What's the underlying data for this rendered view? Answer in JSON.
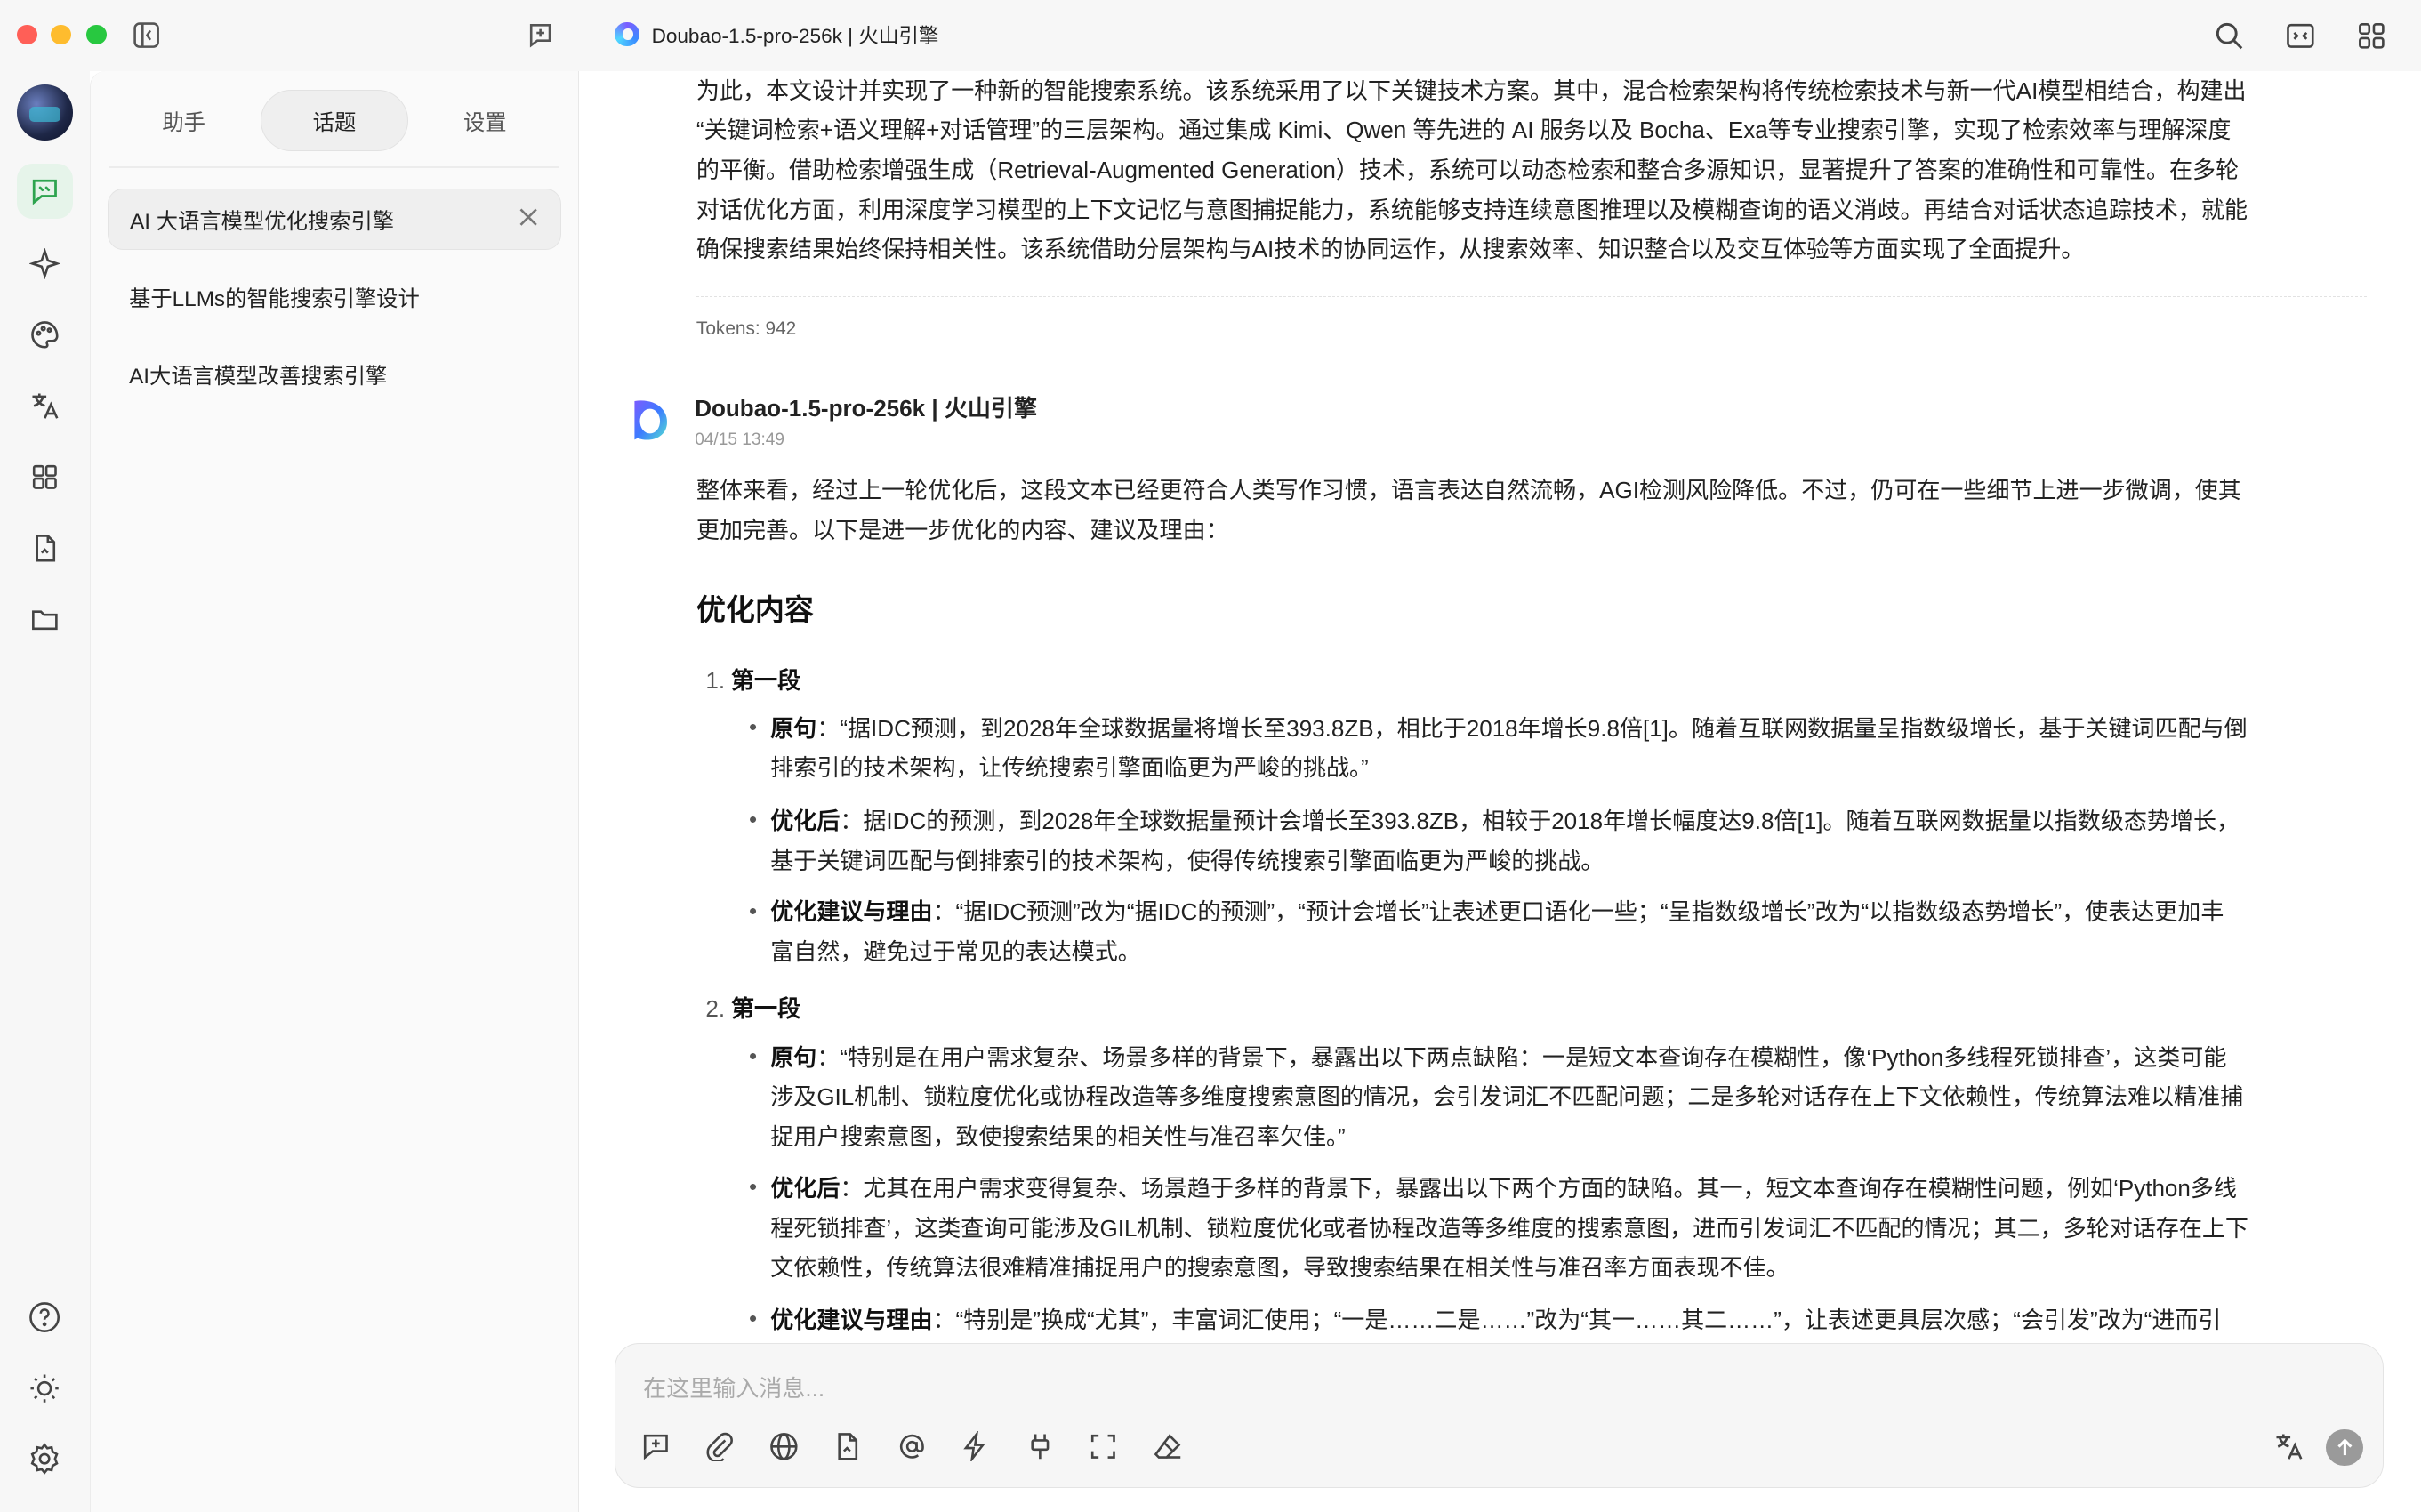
{
  "window": {
    "title": "Doubao-1.5-pro-256k | 火山引擎"
  },
  "panel": {
    "tabs": [
      "助手",
      "话题",
      "设置"
    ],
    "active_tab": "话题",
    "topics": [
      "AI 大语言模型优化搜索引擎",
      "基于LLMs的智能搜索引擎设计",
      "AI大语言模型改善搜索引擎"
    ]
  },
  "prev_message": {
    "lines": [
      "为此，本文设计并实现了一种新的智能搜索系统。该系统采用了以下关键技术方案。其中，混合检索架构将传统检索技术与新一代AI模型相结合，构建出",
      "“关键词检索+语义理解+对话管理”的三层架构。通过集成 Kimi、Qwen 等先进的 AI 服务以及 Bocha、Exa等专业搜索引擎，实现了检索效率与理解深度",
      "的平衡。借助检索增强生成（Retrieval-Augmented Generation）技术，系统可以动态检索和整合多源知识，显著提升了答案的准确性和可靠性。在多轮",
      "对话优化方面，利用深度学习模型的上下文记忆与意图捕捉能力，系统能够支持连续意图推理以及模糊查询的语义消歧。再结合对话状态追踪技术，就能",
      "确保搜索结果始终保持相关性。该系统借助分层架构与AI技术的协同运作，从搜索效率、知识整合以及交互体验等方面实现了全面提升。"
    ],
    "tokens": "Tokens: 942"
  },
  "message": {
    "model": "Doubao-1.5-pro-256k | 火山引擎",
    "time": "04/15 13:49",
    "intro": [
      "整体来看，经过上一轮优化后，这段文本已经更符合人类写作习惯，语言表达自然流畅，AGI检测风险降低。不过，仍可在一些细节上进一步微调，使其",
      "更加完善。以下是进一步优化的内容、建议及理由："
    ],
    "heading": "优化内容",
    "sections": [
      {
        "num": "1.",
        "title": "第一段",
        "items": [
          {
            "label": "原句",
            "lines": [
              "：“据IDC预测，到2028年全球数据量将增长至393.8ZB，相比于2018年增长9.8倍[1]。随着互联网数据量呈指数级增长，基于关键词匹配与倒",
              "排索引的技术架构，让传统搜索引擎面临更为严峻的挑战。”"
            ]
          },
          {
            "label": "优化后",
            "lines": [
              "：据IDC的预测，到2028年全球数据量预计会增长至393.8ZB，相较于2018年增长幅度达9.8倍[1]。随着互联网数据量以指数级态势增长，",
              "基于关键词匹配与倒排索引的技术架构，使得传统搜索引擎面临更为严峻的挑战。"
            ]
          },
          {
            "label": "优化建议与理由",
            "lines": [
              "：“据IDC预测”改为“据IDC的预测”，“预计会增长”让表述更口语化一些；“呈指数级增长”改为“以指数级态势增长”，使表达更加丰",
              "富自然，避免过于常见的表达模式。"
            ]
          }
        ]
      },
      {
        "num": "2.",
        "title": "第一段",
        "items": [
          {
            "label": "原句",
            "lines": [
              "：“特别是在用户需求复杂、场景多样的背景下，暴露出以下两点缺陷：一是短文本查询存在模糊性，像‘Python多线程死锁排查’，这类可能",
              "涉及GIL机制、锁粒度优化或协程改造等多维度搜索意图的情况，会引发词汇不匹配问题；二是多轮对话存在上下文依赖性，传统算法难以精准捕",
              "捉用户搜索意图，致使搜索结果的相关性与准召率欠佳。”"
            ]
          },
          {
            "label": "优化后",
            "lines": [
              "：尤其在用户需求变得复杂、场景趋于多样的背景下，暴露出以下两个方面的缺陷。其一，短文本查询存在模糊性问题，例如‘Python多线",
              "程死锁排查’，这类查询可能涉及GIL机制、锁粒度优化或者协程改造等多维度的搜索意图，进而引发词汇不匹配的情况；其二，多轮对话存在上下",
              "文依赖性，传统算法很难精准捕捉用户的搜索意图，导致搜索结果在相关性与准召率方面表现不佳。"
            ]
          },
          {
            "label": "优化建议与理由",
            "lines": [
              "：“特别是”换成“尤其”，丰富词汇使用；“一是……二是……”改为“其一……其二……”，让表述更具层次感；“会引发”改为“进而引"
            ]
          }
        ]
      }
    ]
  },
  "input": {
    "placeholder": "在这里输入消息..."
  },
  "icons": {
    "rail": [
      "avatar",
      "chat-icon",
      "sparkle-icon",
      "palette-icon",
      "translate-icon",
      "apps-icon",
      "document-icon",
      "folder-icon",
      "help-icon",
      "brightness-icon",
      "settings-icon"
    ],
    "input_toolbar": [
      "new-topic-icon",
      "attach-icon",
      "web-search-icon",
      "knowledge-icon",
      "mention-icon",
      "quick-phrase-icon",
      "mcp-icon",
      "fullscreen-icon",
      "clear-icon",
      "translate-icon",
      "send-icon"
    ]
  },
  "colors": {
    "accent": "#2ea44f",
    "traffic_red": "#ff5f57",
    "traffic_yellow": "#febc2e",
    "traffic_green": "#28c840"
  }
}
